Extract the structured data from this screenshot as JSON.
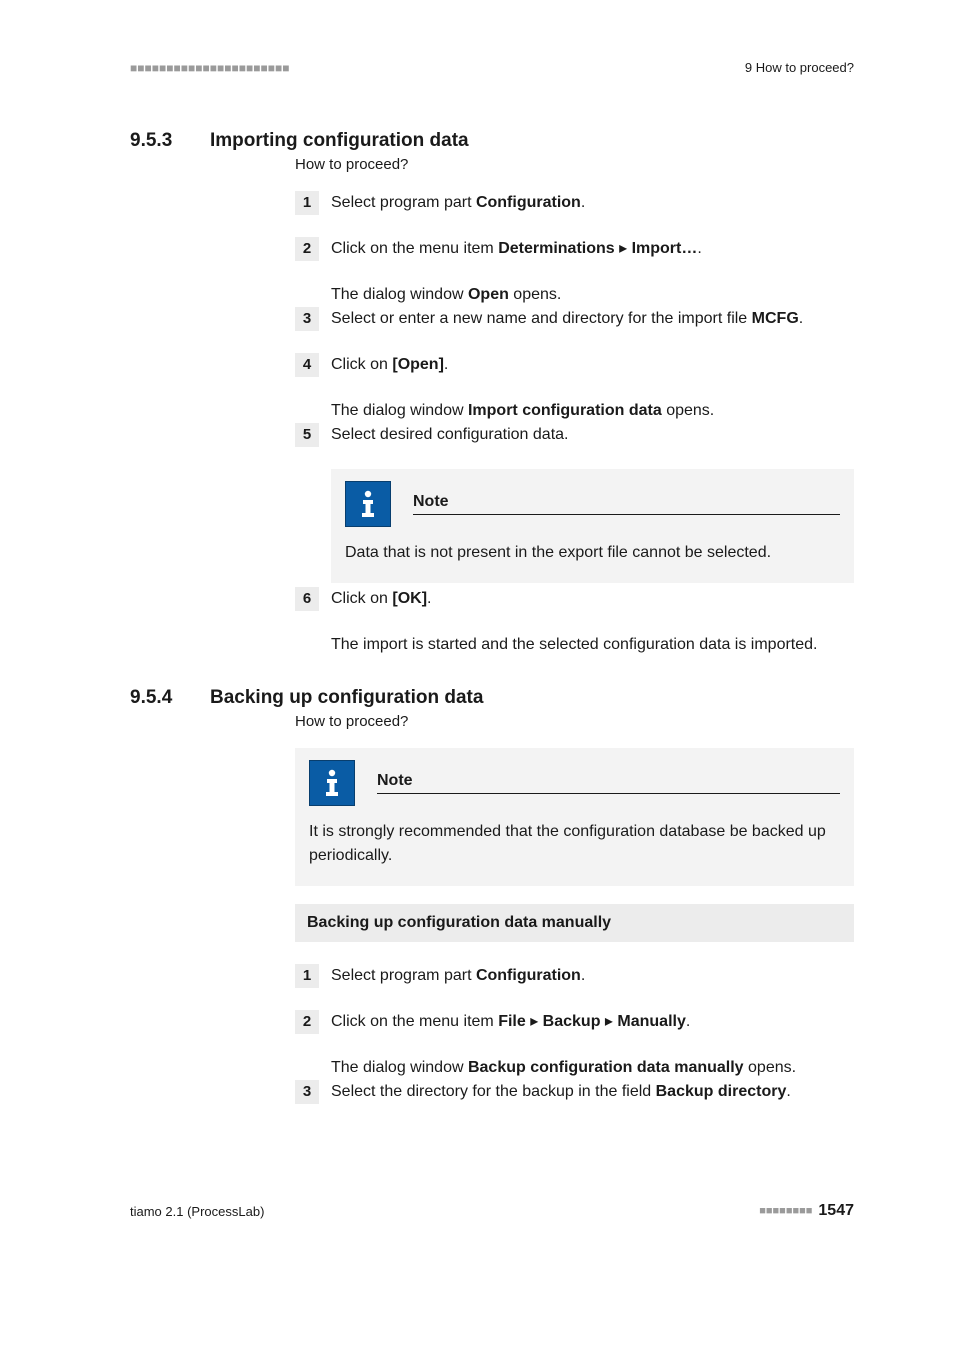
{
  "header": {
    "dots_left": "■■■■■■■■■■■■■■■■■■■■■■",
    "right": "9 How to proceed?"
  },
  "section1": {
    "num": "9.5.3",
    "title": "Importing configuration data",
    "subtitle": "How to proceed?",
    "steps": [
      {
        "n": "1",
        "html": "Select program part <b>Configuration</b>."
      },
      {
        "n": "2",
        "html": "Click on the menu item <b>Determinations</b> ▸ <b>Import…</b>.",
        "sub": "The dialog window <b>Open</b> opens."
      },
      {
        "n": "3",
        "html": "Select or enter a new name and directory for the import file <b>MCFG</b>."
      },
      {
        "n": "4",
        "html": "Click on <b>[Open]</b>.",
        "sub": "The dialog window <b>Import configuration data</b> opens."
      },
      {
        "n": "5",
        "html": "Select desired configuration data.",
        "note": {
          "title": "Note",
          "body": "Data that is not present in the export file cannot be selected."
        }
      },
      {
        "n": "6",
        "html": "Click on <b>[OK]</b>.",
        "sub": "The import is started and the selected configuration data is imported."
      }
    ]
  },
  "section2": {
    "num": "9.5.4",
    "title": "Backing up configuration data",
    "subtitle": "How to proceed?",
    "note": {
      "title": "Note",
      "body": "It is strongly recommended that the configuration database be backed up periodically."
    },
    "subhead": "Backing up configuration data manually",
    "steps": [
      {
        "n": "1",
        "html": "Select program part <b>Configuration</b>."
      },
      {
        "n": "2",
        "html": "Click on the menu item <b>File</b> ▸ <b>Backup</b> ▸ <b>Manually</b>.",
        "sub": "The dialog window <b>Backup configuration data manually</b> opens."
      },
      {
        "n": "3",
        "html": "Select the directory for the backup in the field <b>Backup directory</b>."
      }
    ]
  },
  "footer": {
    "left": "tiamo 2.1 (ProcessLab)",
    "dots_right": "■■■■■■■■",
    "page": "1547"
  }
}
